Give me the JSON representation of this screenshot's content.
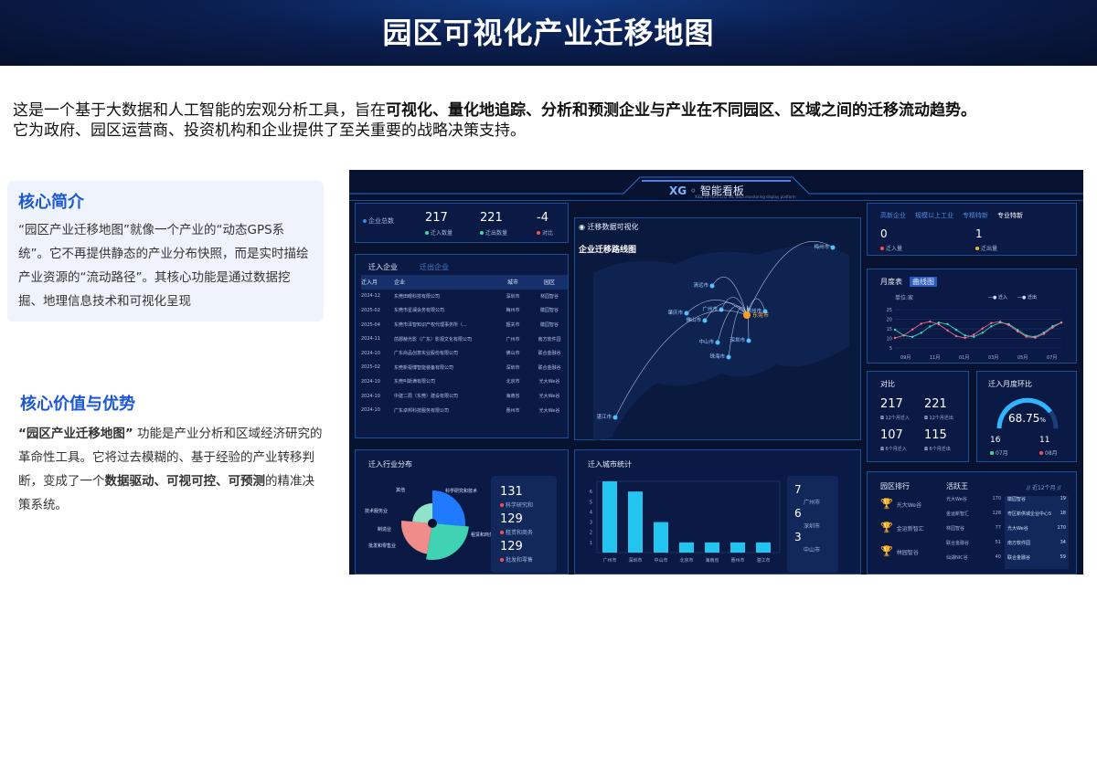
{
  "banner": {
    "title": "园区可视化产业迁移地图"
  },
  "intro": {
    "part1": "这是一个基于大数据和人工智能的宏观分析工具，旨在",
    "bold": "可视化、量化地追踪、分析和预测企业与产业在不同园区、区域之间的迁移流动趋势。",
    "part2": "它为政府、园区运营商、投资机构和企业提供了至关重要的战略决策支持。"
  },
  "core_intro": {
    "title": "核心简介",
    "body": "“园区产业迁移地图”就像一个产业的“动态GPS系统”。它不再提供静态的产业分布快照，而是实时描绘产业资源的“流动路径”。其核心功能是通过数据挖掘、地理信息技术和可视化呈现"
  },
  "core_value": {
    "title": "核心价值与优势",
    "bold1": "“园区产业迁移地图”",
    "text1": " 功能是产业分析和区域经济研究的革命性工具。它将过去模糊的、基于经验的产业转移判断，变成了一个",
    "bold2": "数据驱动、可视可控、可预测",
    "text2": "的精准决策系统。"
  },
  "dashboard": {
    "header_title": "智能看板",
    "header_sub": "XiGu HI-TECH LTD INC data monitoring display platform",
    "kpi": {
      "label": "企业总数",
      "in_val": "217",
      "in_label": "迁入数量",
      "out_val": "221",
      "out_label": "迁出数量",
      "diff_val": "-4",
      "diff_label": "对比"
    },
    "table": {
      "tabs": [
        "迁入企业",
        "迁出企业"
      ],
      "headers": [
        "迁入月",
        "企业",
        "城市",
        "园区"
      ],
      "rows": [
        [
          "2024-12",
          "东莞田眼科技有限公司",
          "深圳市",
          "林园智谷"
        ],
        [
          "2025-02",
          "东莞市星澜会务有限公司",
          "梅州市",
          "徽园智谷"
        ],
        [
          "2025-04",
          "东莞市泽智知识产权代理事务所（...",
          "韶关市",
          "徽园智谷"
        ],
        [
          "2024-11",
          "前郡赫光影（广东）影视文化有限公司",
          "广州市",
          "南方软件园"
        ],
        [
          "2024-10",
          "广东尚品创意实业股份有限公司",
          "佛山市",
          "联合金融谷"
        ],
        [
          "2025-02",
          "东莞新视博智能装备有限公司",
          "深圳市",
          "联合金融谷"
        ],
        [
          "2024-10",
          "东莞叫斯满有限公司",
          "北京市",
          "光大We谷"
        ],
        [
          "2024-10",
          "中建二局（东莞）建设有限公司",
          "海南省",
          "光大We谷"
        ],
        [
          "2024-10",
          "广东卓邦科技服务有限公司",
          "惠州市",
          "光大We谷"
        ]
      ]
    },
    "map": {
      "section_title": "迁移数据可视化",
      "title": "企业迁移路线图",
      "center": "东莞市",
      "cities": [
        "梅州市",
        "清远市",
        "广州市",
        "肇庆市",
        "佛山市",
        "惠州市",
        "中山市",
        "深圳市",
        "珠海市",
        "湛江市"
      ]
    },
    "tabs_right": {
      "items": [
        "高新企业",
        "规模以上工业",
        "专精特新",
        "专业特新"
      ],
      "in_val": "0",
      "in_label": "迁入量",
      "out_val": "1",
      "out_label": "迁出量"
    },
    "month_chart": {
      "tabs": [
        "月度表",
        "曲线图"
      ],
      "unit": "单位:家",
      "legend": [
        "迁入",
        "迁出"
      ],
      "x_ticks": [
        "09月",
        "11月",
        "01月",
        "03月",
        "05月",
        "07月"
      ],
      "y_ticks": [
        "25",
        "20",
        "15",
        "10",
        "5"
      ]
    },
    "compare": {
      "title": "对比",
      "a_val": "217",
      "a_label": "12个月迁入",
      "b_val": "221",
      "b_label": "12个月迁出",
      "c_val": "107",
      "c_label": "6个月迁入",
      "d_val": "115",
      "d_label": "6个月迁出"
    },
    "ring": {
      "title": "迁入月度环比",
      "pct": "68.75",
      "unit": "%",
      "left_val": "16",
      "left_label": "07月",
      "right_val": "11",
      "right_label": "08月"
    },
    "industry": {
      "title": "迁入行业分布",
      "labels": [
        "其他",
        "批发和零售业",
        "技术服务业",
        "制造业",
        "科学研究和技术",
        "租赁和商务"
      ],
      "v1": "131",
      "l1": "科学研究和",
      "v2": "129",
      "l2": "租赁和商务",
      "v3": "129",
      "l3": "批发和零售"
    },
    "cities_chart": {
      "title": "迁入城市统计",
      "chart_data": {
        "type": "bar",
        "categories": [
          "广州市",
          "深圳市",
          "中山市",
          "北京市",
          "海南省",
          "惠州市",
          "湛江市"
        ],
        "values": [
          7,
          6,
          3,
          1,
          1,
          1,
          1
        ],
        "ylim": [
          0,
          7
        ],
        "y_ticks": [
          "6",
          "5",
          "4",
          "3",
          "2",
          "1"
        ]
      },
      "side": [
        {
          "val": "7",
          "label": "广州市"
        },
        {
          "val": "6",
          "label": "深圳市"
        },
        {
          "val": "3",
          "label": "中山市"
        }
      ]
    },
    "rank": {
      "tab1": "园区排行",
      "tab2": "活跃王",
      "period": "// 近12个月 //",
      "left": [
        "光大We谷",
        "金运新智汇",
        "林园智谷"
      ],
      "mid": [
        [
          "光大We谷",
          "170"
        ],
        [
          "金运新智汇",
          "128"
        ],
        [
          "林园智谷",
          "77"
        ],
        [
          "联合金融谷",
          "51"
        ],
        [
          "仙湖NIC谷",
          "40"
        ]
      ],
      "right": [
        [
          "徽园智谷",
          "19"
        ],
        [
          "粤区新供城企业中心5",
          "18"
        ],
        [
          "光大We谷",
          "170"
        ],
        [
          "南方软件园",
          "34"
        ],
        [
          "联合金融谷",
          "59"
        ]
      ]
    }
  }
}
